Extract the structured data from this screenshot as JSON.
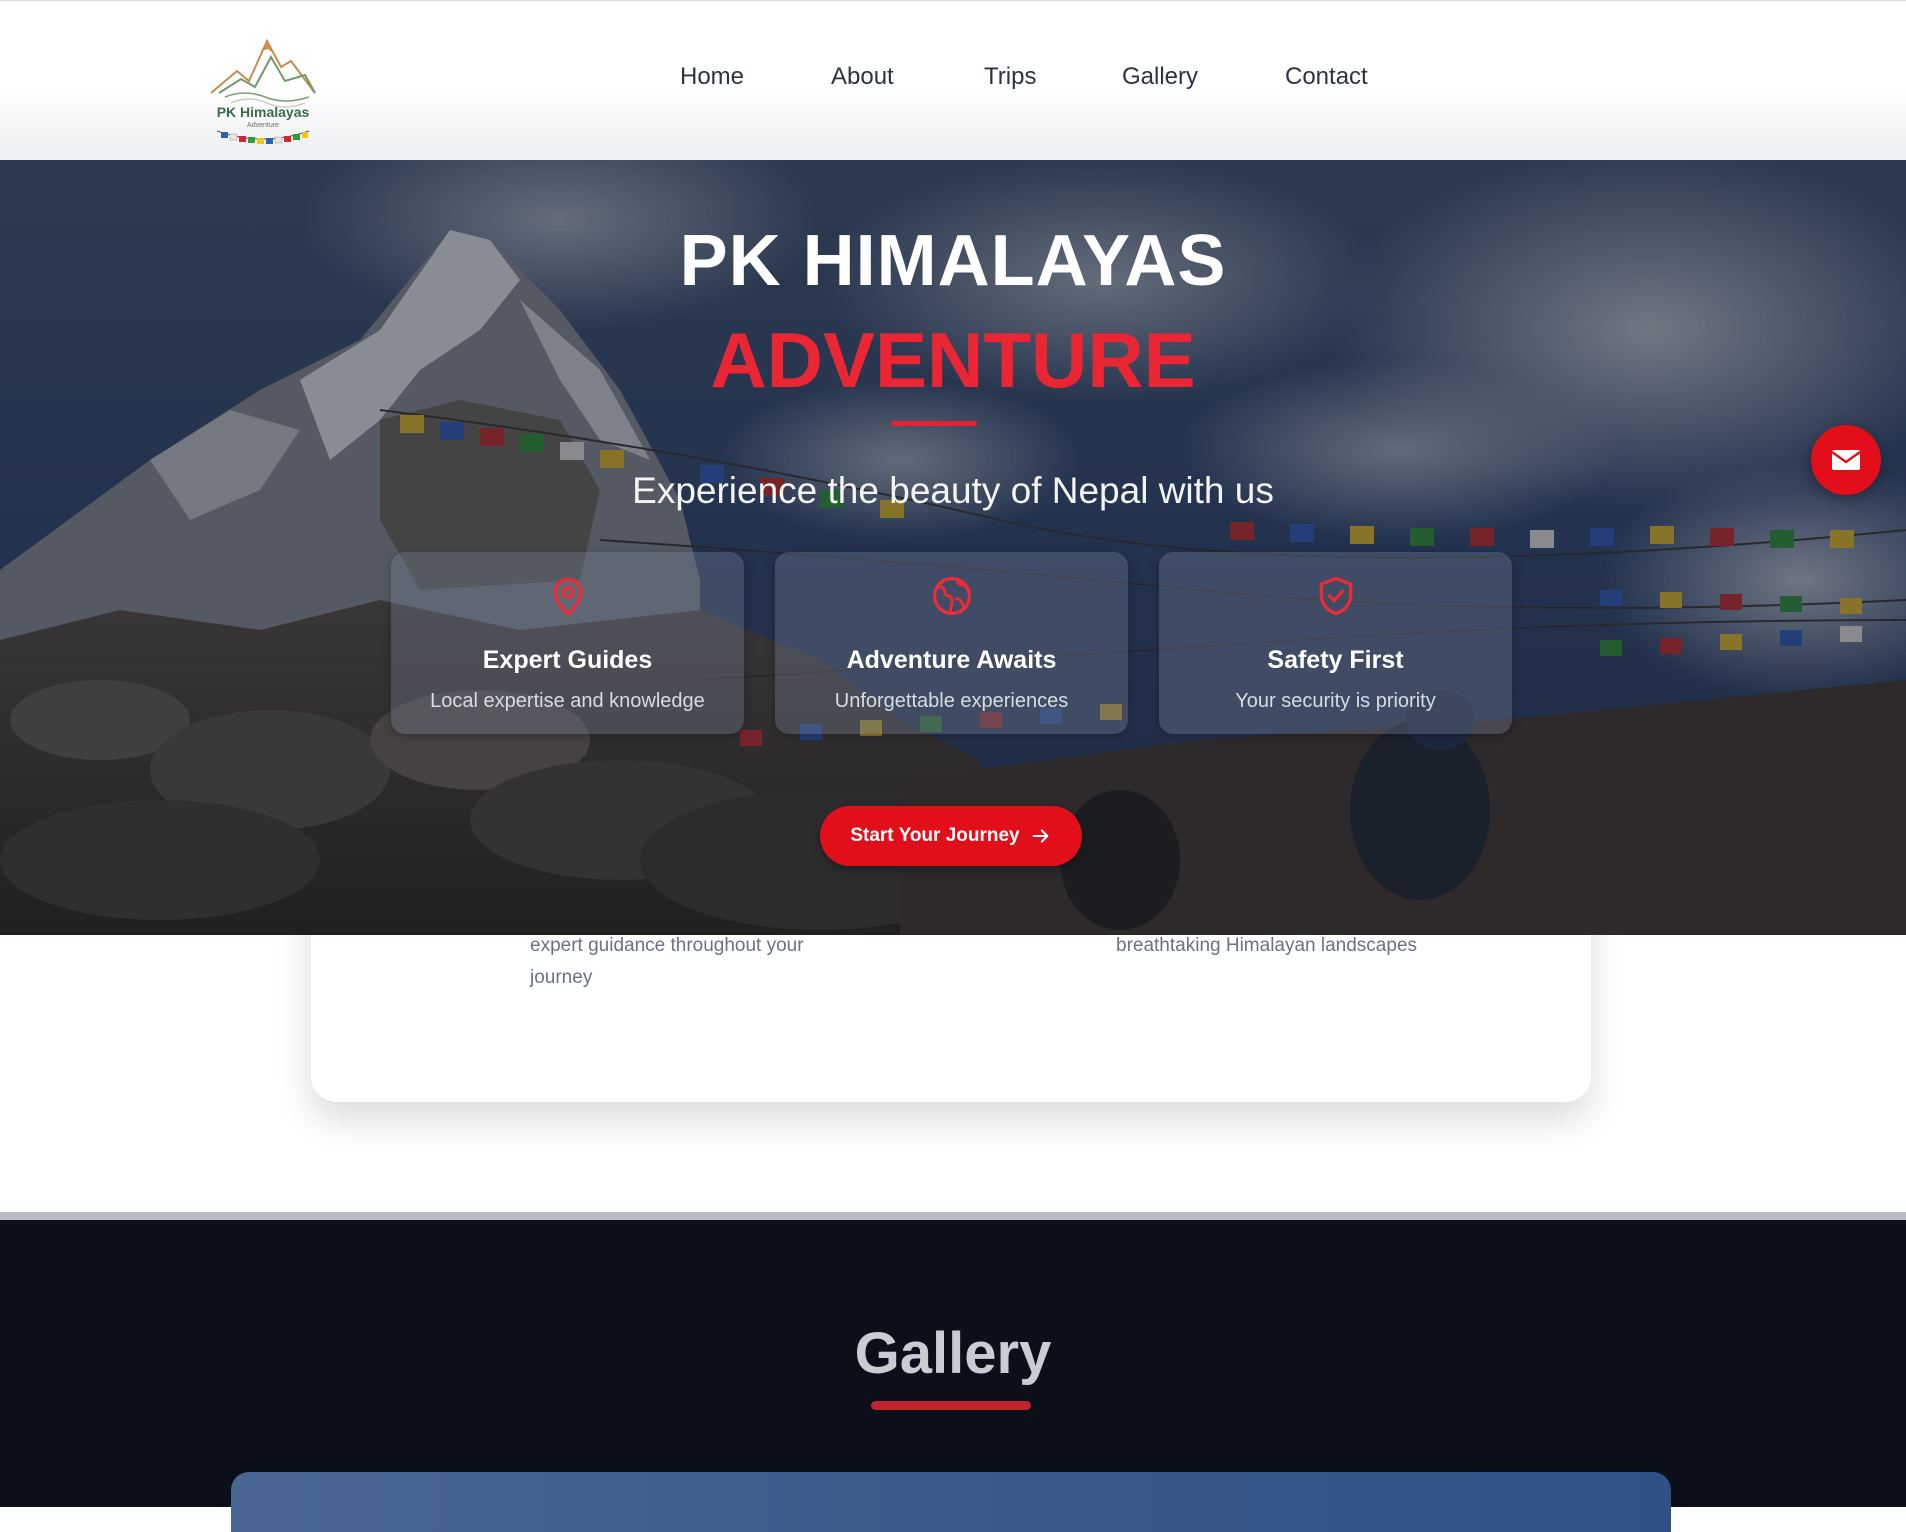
{
  "brand": {
    "logo_title": "PK Himalayas",
    "logo_subtitle": "Adventure"
  },
  "nav": {
    "items": [
      "Home",
      "About",
      "Trips",
      "Gallery",
      "Contact"
    ]
  },
  "hero": {
    "title": "PK HIMALAYAS",
    "title_accent": "ADVENTURE",
    "subtitle": "Experience the beauty of Nepal with us",
    "features": [
      {
        "icon": "map-pin-icon",
        "title": "Expert Guides",
        "desc": "Local expertise and knowledge"
      },
      {
        "icon": "globe-icon",
        "title": "Adventure Awaits",
        "desc": "Unforgettable experiences"
      },
      {
        "icon": "shield-check-icon",
        "title": "Safety First",
        "desc": "Your security is priority"
      }
    ],
    "cta_label": "Start Your Journey"
  },
  "about": {
    "left_text": "expert guidance throughout your journey",
    "right_text": "breathtaking Himalayan landscapes"
  },
  "gallery": {
    "title": "Gallery"
  },
  "colors": {
    "accent": "#e20f1b",
    "accent_text": "#ea2634",
    "nav_text": "#2c3440",
    "gallery_bg": "#0b0f1a"
  }
}
